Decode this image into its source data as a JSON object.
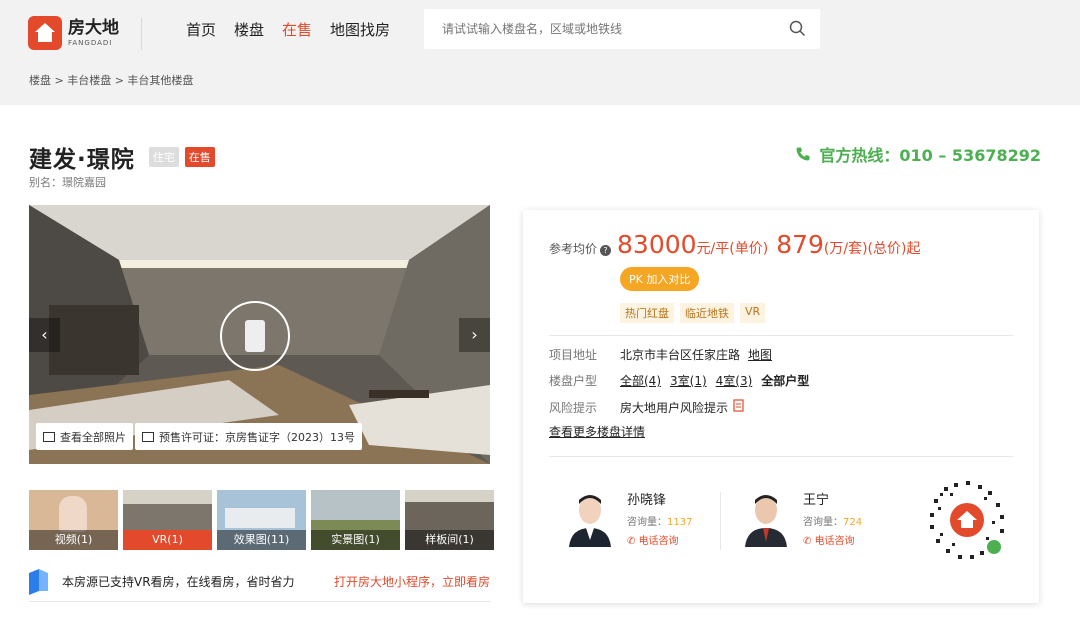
{
  "brand": {
    "name": "房大地",
    "name_en": "FANGDADI"
  },
  "nav": {
    "items": [
      "首页",
      "楼盘",
      "在售",
      "地图找房"
    ],
    "active": "在售"
  },
  "search": {
    "placeholder": "请试试输入楼盘名，区域或地铁线"
  },
  "breadcrumb": "楼盘 > 丰台楼盘 > 丰台其他楼盘",
  "project": {
    "name": "建发·璟院",
    "tags": [
      "住宅",
      "在售"
    ],
    "alias": "别名：璟院嘉园"
  },
  "hotline": "官方热线：010 – 53678292",
  "gallery": {
    "view_all": "查看全部照片",
    "license": "预售许可证：京房售证字（2023）13号",
    "thumbs": [
      "视频(1)",
      "VR(1)",
      "效果图(11)",
      "实景图(1)",
      "样板间(1)"
    ]
  },
  "vr_banner": {
    "message": "本房源已支持VR看房，在线看房，省时省力",
    "link": "打开房大地小程序，立即看房"
  },
  "price": {
    "label": "参考均价",
    "unit_value": "83000",
    "unit_text": "元/平(单价)",
    "total_value": "879",
    "total_text": "(万/套)(总价)起"
  },
  "pk_button": "PK 加入对比",
  "badges": [
    "热门红盘",
    "临近地铁",
    "VR"
  ],
  "details": {
    "address_label": "项目地址",
    "address": "北京市丰台区任家庄路",
    "map_link": "地图",
    "layout_label": "楼盘户型",
    "layouts": [
      "全部(4)",
      "3室(1)",
      "4室(3)",
      "全部户型"
    ],
    "risk_label": "风险提示",
    "risk_text": "房大地用户风险提示",
    "more": "查看更多楼盘详情"
  },
  "agents": [
    {
      "name": "孙晓锋",
      "count_label": "咨询量：",
      "count": "1137",
      "call": "电话咨询"
    },
    {
      "name": "王宁",
      "count_label": "咨询量：",
      "count": "724",
      "call": "电话咨询"
    }
  ],
  "colors": {
    "brand_red": "#e24a2b",
    "hotline_green": "#4caf50",
    "accent_orange": "#f5a623"
  }
}
